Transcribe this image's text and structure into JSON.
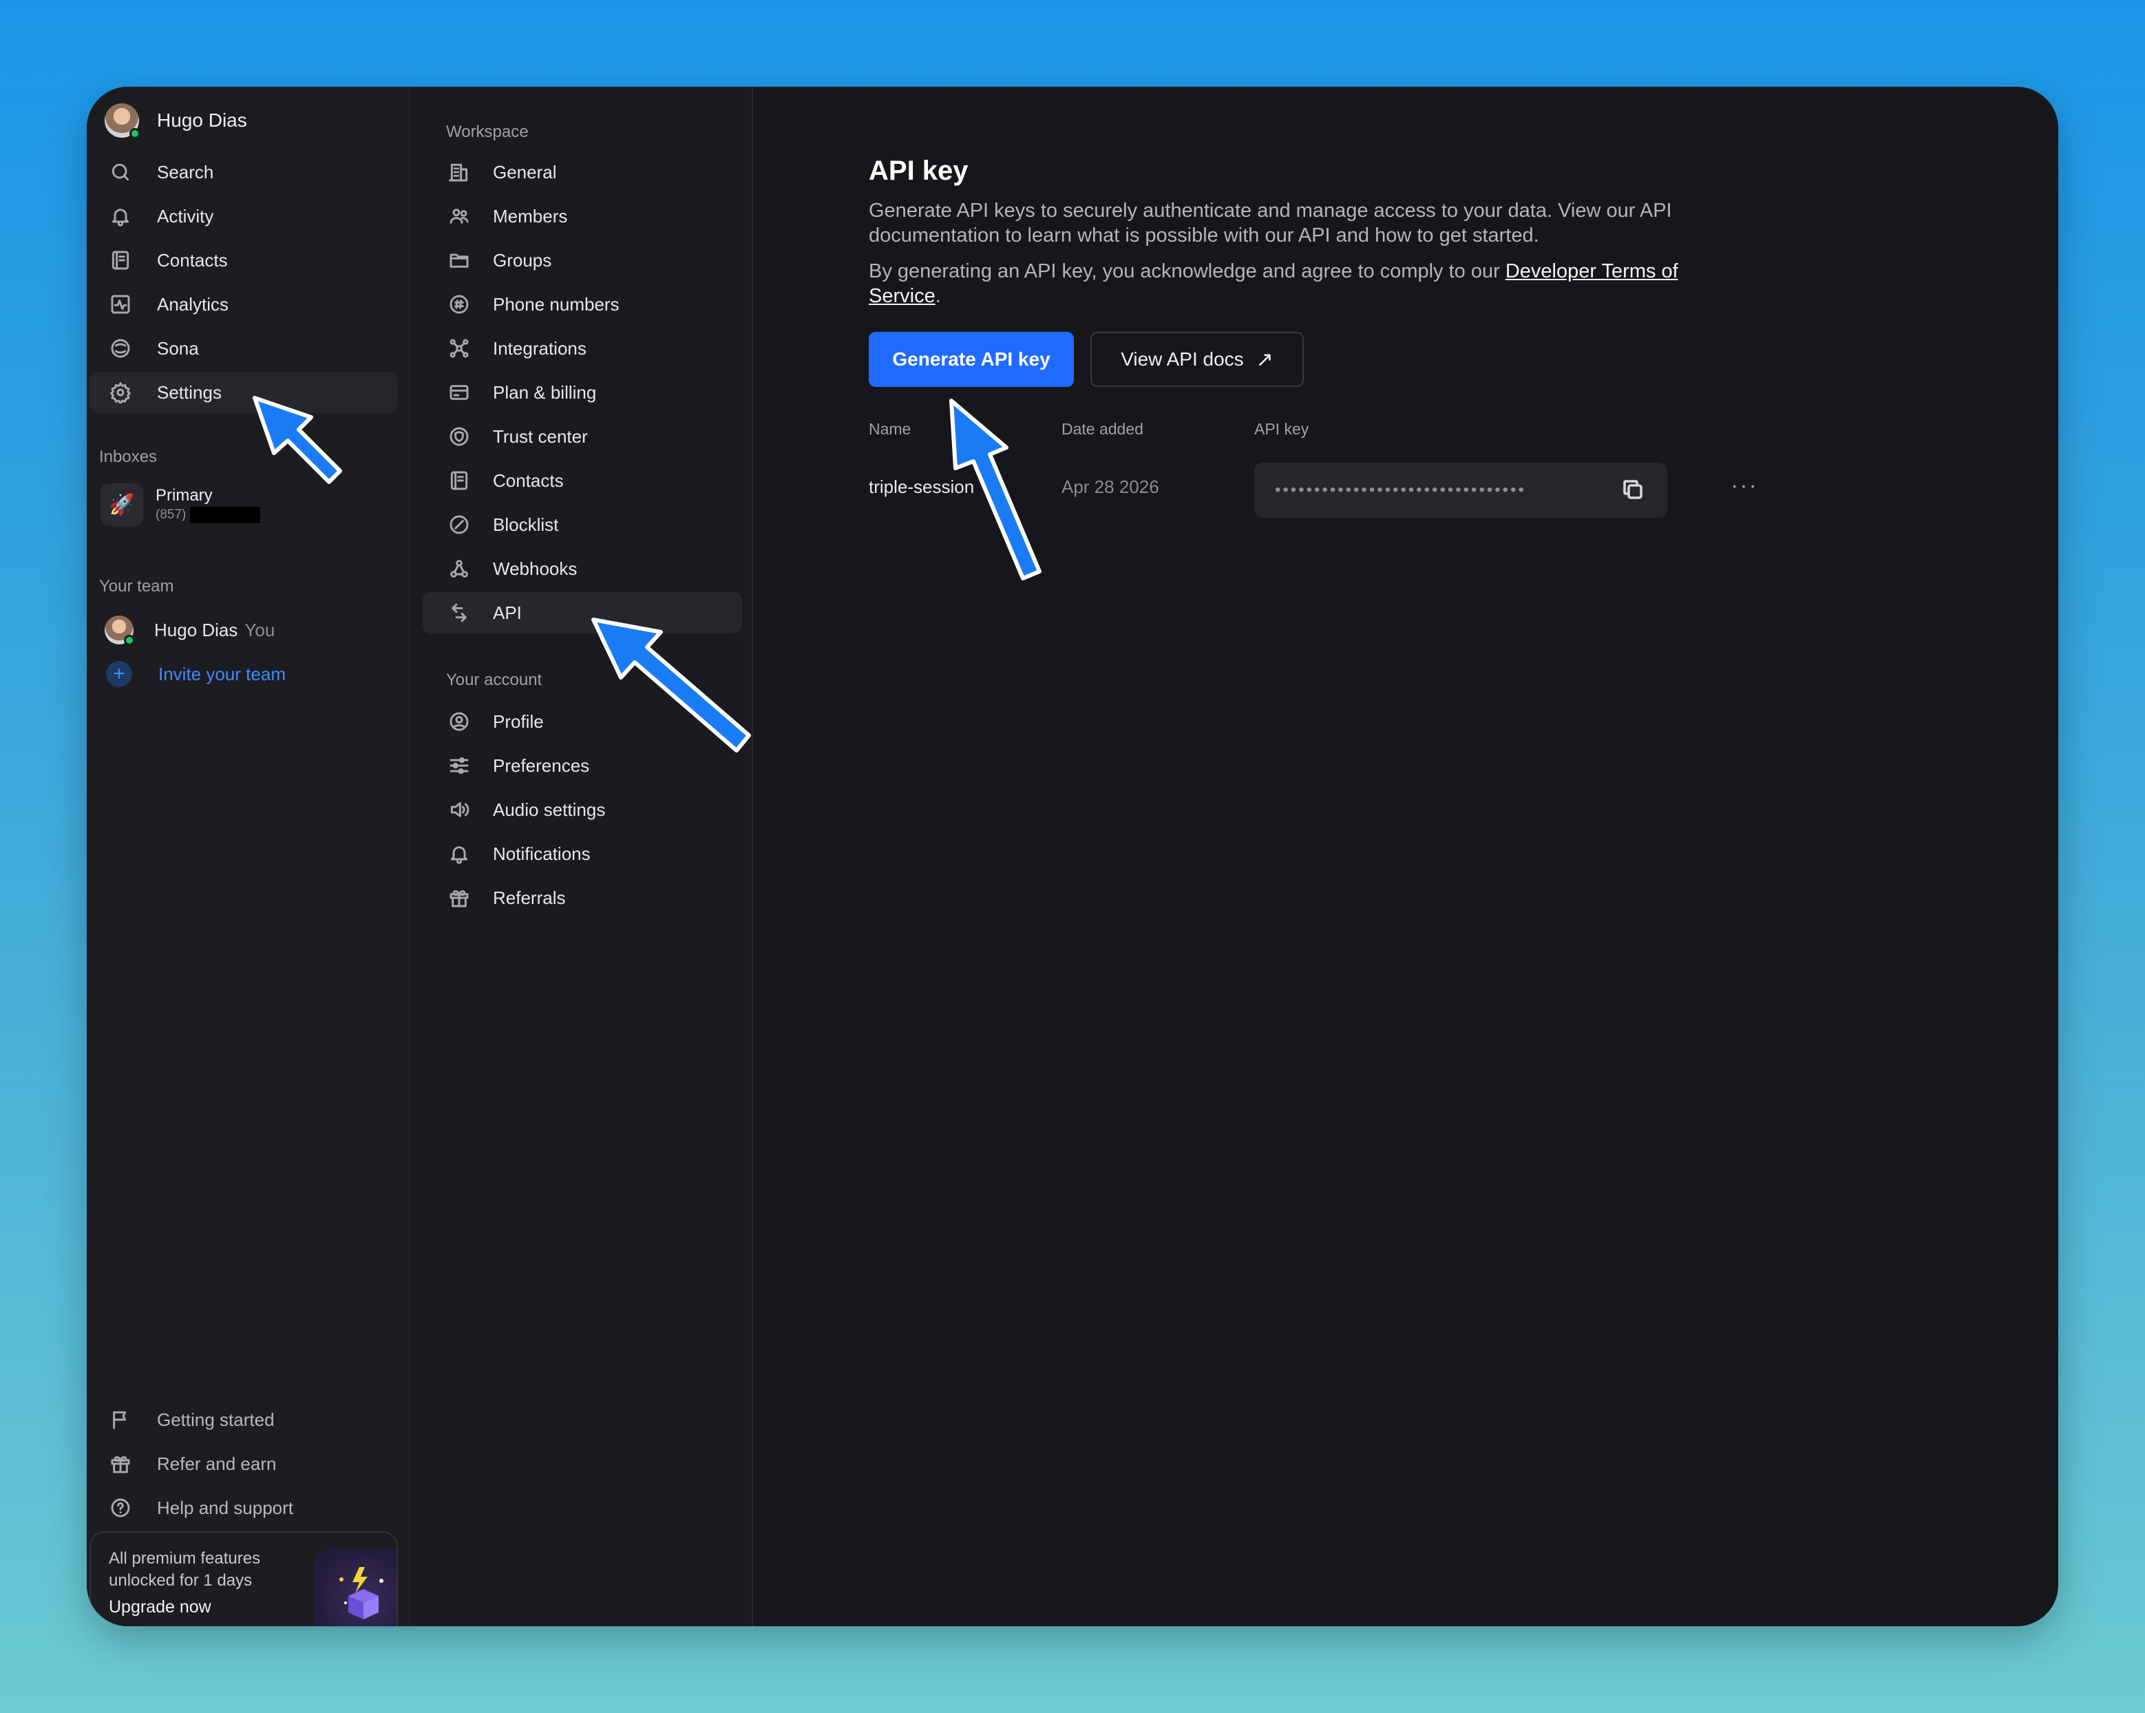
{
  "user": {
    "name": "Hugo Dias"
  },
  "sidebar": {
    "items": [
      {
        "label": "Search",
        "icon": "search-icon"
      },
      {
        "label": "Activity",
        "icon": "bell-icon"
      },
      {
        "label": "Contacts",
        "icon": "contacts-book-icon"
      },
      {
        "label": "Analytics",
        "icon": "analytics-icon"
      },
      {
        "label": "Sona",
        "icon": "sona-icon"
      },
      {
        "label": "Settings",
        "icon": "gear-icon",
        "active": true
      }
    ],
    "inboxes_label": "Inboxes",
    "inbox": {
      "name": "Primary",
      "count": "(857)",
      "icon": "rocket-icon"
    },
    "team_label": "Your team",
    "team_member": {
      "name": "Hugo Dias",
      "tag": "You"
    },
    "invite_label": "Invite your team",
    "bottom_items": [
      {
        "label": "Getting started",
        "icon": "flag-icon"
      },
      {
        "label": "Refer and earn",
        "icon": "gift-icon"
      },
      {
        "label": "Help and support",
        "icon": "help-icon"
      }
    ],
    "upgrade": {
      "text": "All premium features unlocked for 1 days",
      "cta": "Upgrade now"
    }
  },
  "settings": {
    "workspace_label": "Workspace",
    "workspace_items": [
      {
        "label": "General",
        "icon": "building-icon"
      },
      {
        "label": "Members",
        "icon": "members-icon"
      },
      {
        "label": "Groups",
        "icon": "folder-icon"
      },
      {
        "label": "Phone numbers",
        "icon": "hash-icon"
      },
      {
        "label": "Integrations",
        "icon": "integrations-icon"
      },
      {
        "label": "Plan & billing",
        "icon": "card-icon"
      },
      {
        "label": "Trust center",
        "icon": "shield-icon"
      },
      {
        "label": "Contacts",
        "icon": "contacts-book-icon"
      },
      {
        "label": "Blocklist",
        "icon": "block-icon"
      },
      {
        "label": "Webhooks",
        "icon": "webhook-icon"
      },
      {
        "label": "API",
        "icon": "api-arrows-icon",
        "active": true
      }
    ],
    "account_label": "Your account",
    "account_items": [
      {
        "label": "Profile",
        "icon": "profile-icon"
      },
      {
        "label": "Preferences",
        "icon": "sliders-icon"
      },
      {
        "label": "Audio settings",
        "icon": "speaker-icon"
      },
      {
        "label": "Notifications",
        "icon": "bell-icon"
      },
      {
        "label": "Referrals",
        "icon": "gift-icon"
      }
    ]
  },
  "main": {
    "title": "API key",
    "description": "Generate API keys to securely authenticate and manage access to your data. View our API documentation to learn what is possible with our API and how to get started.",
    "terms_prefix": "By generating an API key, you acknowledge and agree to comply to our ",
    "terms_link": "Developer Terms of Service",
    "terms_suffix": ".",
    "generate_button": "Generate API key",
    "docs_button": "View API docs",
    "table": {
      "headers": [
        "Name",
        "Date added",
        "API key"
      ],
      "rows": [
        {
          "name": "triple-session",
          "date": "Apr 28 2026",
          "key": "••••••••••••••••••••••••••••••••"
        }
      ]
    },
    "more_label": "···"
  },
  "colors": {
    "accent": "#1f6bff",
    "annotation_arrow": "#1a7cf5",
    "background": "#17171b"
  }
}
